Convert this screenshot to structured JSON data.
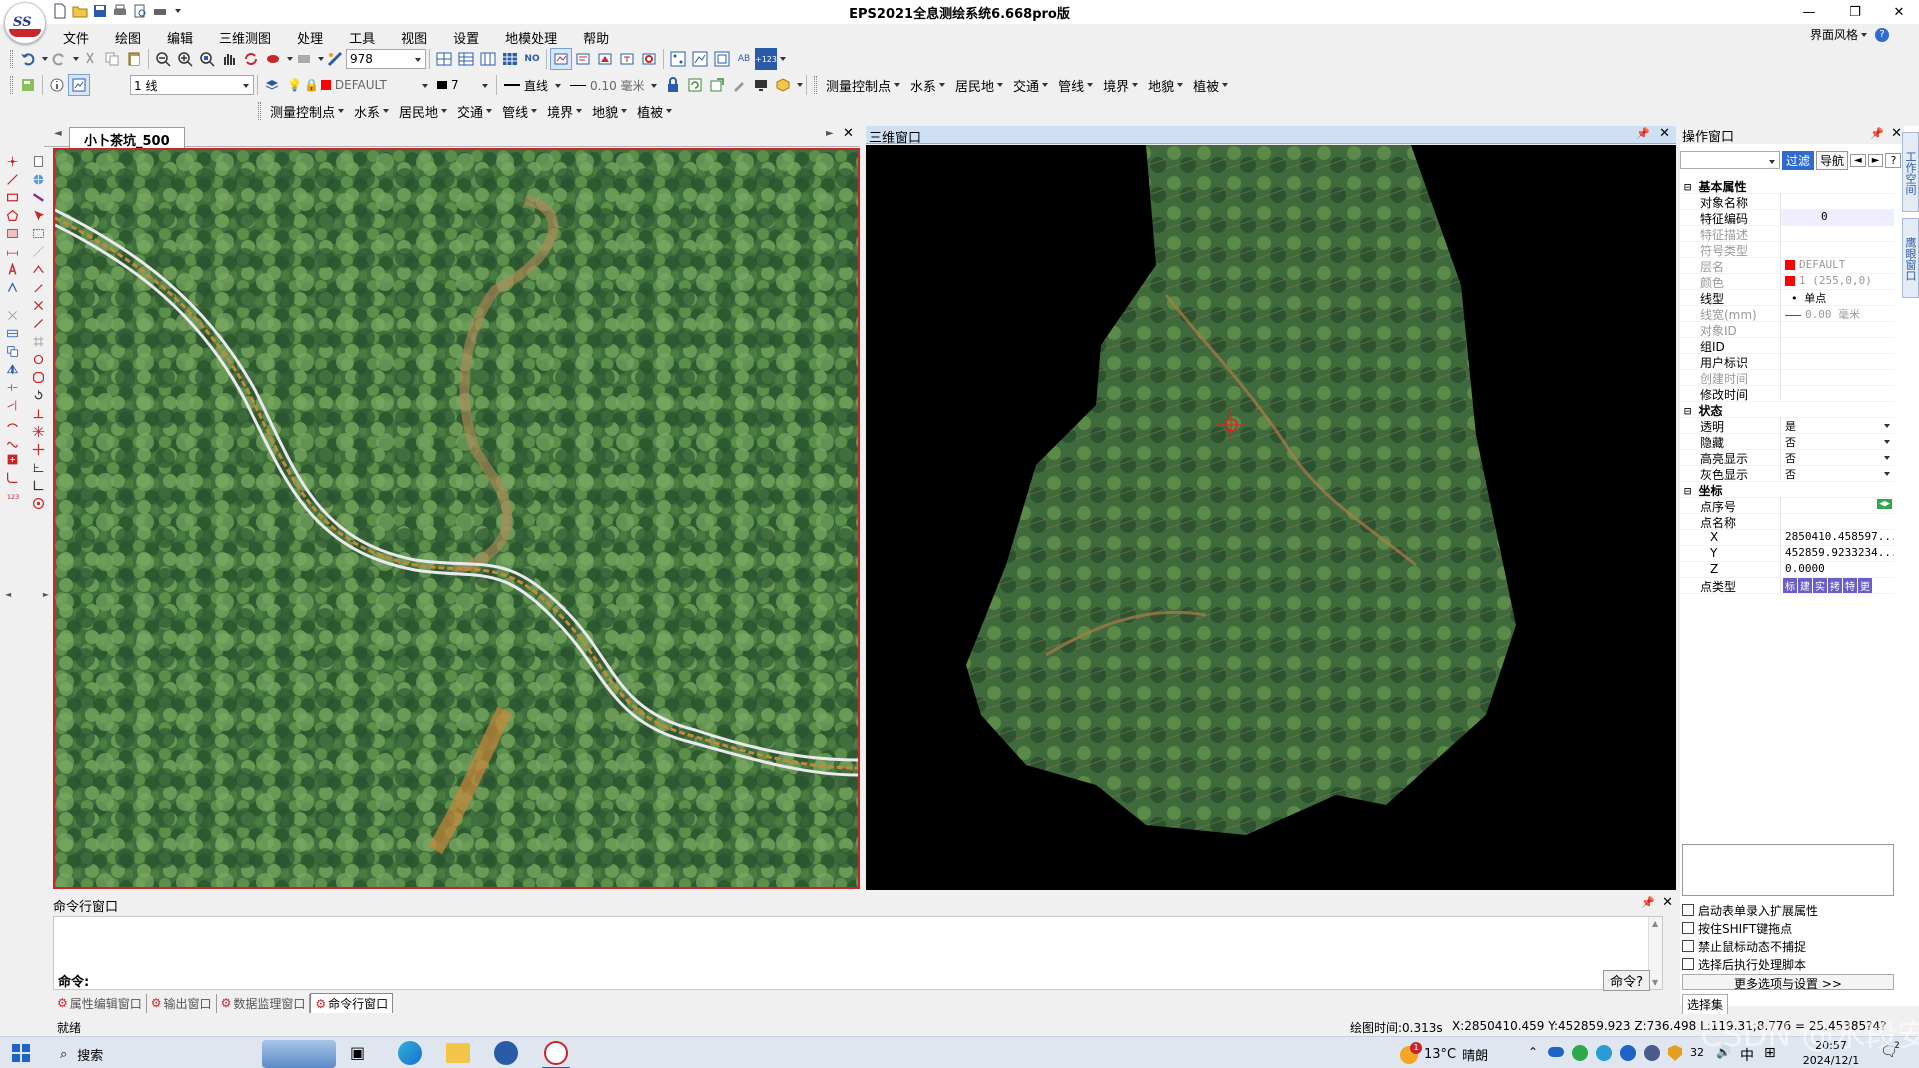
{
  "app": {
    "title": "EPS2021全息测绘系统6.668pro版",
    "logo_text": "SS",
    "style_menu": "界面风格"
  },
  "menu": [
    "文件",
    "绘图",
    "编辑",
    "三维测图",
    "处理",
    "工具",
    "视图",
    "设置",
    "地模处理",
    "帮助"
  ],
  "toolbar1": {
    "scale_value": "978"
  },
  "toolbar2": {
    "layer": "1 线",
    "layer_name": "DEFAULT",
    "color_index": "7",
    "line_type": "直线",
    "line_width": "0.10 毫米"
  },
  "feature_menus": [
    "测量控制点",
    "水系",
    "居民地",
    "交通",
    "管线",
    "境界",
    "地貌",
    "植被"
  ],
  "map_window": {
    "tab_label": "小卜茶坑_500"
  },
  "window_3d": {
    "title": "三维窗口"
  },
  "properties": {
    "title": "操作窗口",
    "filter_btn": "过滤",
    "nav_btn": "导航",
    "help_btn": "?",
    "side_tab_1": "工作空间",
    "side_tab_2": "鹰眼窗口",
    "groups": {
      "basic": "基本属性",
      "state": "状态",
      "coords": "坐标"
    },
    "basic_rows": [
      {
        "k": "对象名称",
        "v": ""
      },
      {
        "k": "特征编码",
        "v": "0"
      },
      {
        "k": "特征描述",
        "v": ""
      },
      {
        "k": "符号类型",
        "v": ""
      },
      {
        "k": "层名",
        "v": "DEFAULT"
      },
      {
        "k": "颜色",
        "v": "1 (255,0,0)"
      },
      {
        "k": "线型",
        "v": "• 单点"
      },
      {
        "k": "线宽(mm)",
        "v": "0.00 毫米"
      },
      {
        "k": "对象ID",
        "v": ""
      },
      {
        "k": "组ID",
        "v": ""
      },
      {
        "k": "用户标识",
        "v": ""
      },
      {
        "k": "创建时间",
        "v": ""
      },
      {
        "k": "修改时间",
        "v": ""
      }
    ],
    "state_rows": [
      {
        "k": "透明",
        "v": "是"
      },
      {
        "k": "隐藏",
        "v": "否"
      },
      {
        "k": "高亮显示",
        "v": "否"
      },
      {
        "k": "灰色显示",
        "v": "否"
      }
    ],
    "coord_rows": [
      {
        "k": "点序号",
        "v": ""
      },
      {
        "k": "点名称",
        "v": ""
      },
      {
        "k": "X",
        "v": "2850410.458597..."
      },
      {
        "k": "Y",
        "v": "452859.9233234..."
      },
      {
        "k": "Z",
        "v": "0.0000"
      },
      {
        "k": "点类型",
        "v": ""
      }
    ],
    "point_type_btns": [
      "标",
      "建",
      "实",
      "拷",
      "特",
      "更"
    ],
    "options": [
      "启动表单录入扩展属性",
      "按住SHIFT键拖点",
      "禁止鼠标动态不捕捉",
      "选择后执行处理脚本"
    ],
    "more_options": "更多选项与设置 >>",
    "select_set": "选择集"
  },
  "command": {
    "title": "命令行窗口",
    "prompt": "命令:",
    "button": "命令?",
    "tabs": [
      "属性编辑窗口",
      "输出窗口",
      "数据监理窗口",
      "命令行窗口"
    ]
  },
  "status": {
    "ready": "就绪",
    "draw_time": "绘图时间:0.313s",
    "coords": "X:2850410.459 Y:452859.923 Z:736.498 L:119.31;8.776 = 25.45385?4?"
  },
  "taskbar": {
    "search": "搜索",
    "weather_temp": "13°C",
    "weather_desc": "晴朗",
    "weather_badge": "1",
    "ime": "中",
    "time": "20:57",
    "date": "2024/12/1",
    "battery": "32",
    "notif": "2",
    "watermark": "CSDN @水段安强"
  },
  "colors": {
    "accent": "#2f6bd1",
    "map_border": "#c8262a",
    "layer_color": "#ff0000"
  }
}
